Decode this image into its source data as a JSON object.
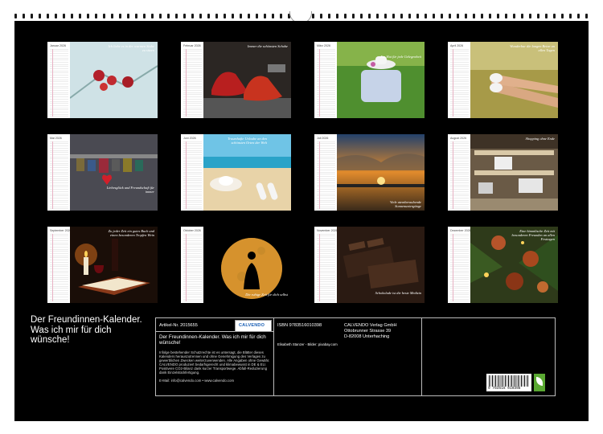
{
  "months": [
    {
      "name": "Januar 2026",
      "caption": "Ich liebe es in der warmen Stube zu sitzen"
    },
    {
      "name": "Februar 2026",
      "caption": "Immer die schönsten Schuhe"
    },
    {
      "name": "März 2026",
      "caption": "Ein Hut für jede Gelegenheit"
    },
    {
      "name": "April 2026",
      "caption": "Wunderbar die langen Beine an allen Tagen"
    },
    {
      "name": "Mai 2026",
      "caption": "Liebesglück und Freundschaft für immer"
    },
    {
      "name": "Juni 2026",
      "caption": "Traumhafte Urlaube an den schönsten Orten der Welt"
    },
    {
      "name": "Juli 2026",
      "caption": "Viele atemberaubende Sonnenuntergänge"
    },
    {
      "name": "August 2026",
      "caption": "Shopping ohne Ende"
    },
    {
      "name": "September 2026",
      "caption": "Zu jeder Zeit ein gutes Buch und einen besonderen Tropfen Wein"
    },
    {
      "name": "Oktober 2026",
      "caption": "Die ruhige Zeit für dich selbst"
    },
    {
      "name": "November 2026",
      "caption": "Schokolade ist die beste Medizin"
    },
    {
      "name": "Dezember 2026",
      "caption": "Eine himmlische Zeit mit besonderen Freunden an allen Festtagen"
    }
  ],
  "footer": {
    "title": "Der Freundinnen-Kalender. Was ich mir für dich wünsche!",
    "article_label": "Artikel-Nr. 2015655",
    "logo": "CALVENDO",
    "product_title": "Der Freundinnen-Kalender. Was ich mir für dich wünsche!",
    "legal_text": "Infolge bestehender Schutzrechte ist es untersagt, die Blätter dieses Kalenders herauszutrennen und ohne Genehmigung des Verlages zu gewerblichen Zwecken weiterzuverwenden. Alle Angaben ohne Gewähr. CALVENDO produziert bedarfsgerecht und klimabewusst in DE & EU. Positivere CO2-Bilanz dank kurzer Transportwege. Abfall-Reduzierung dank Einzelstückfertigung.",
    "contact": "E-Mail: info@calvendo.com • www.calvendo.com",
    "isbn": "ISBN 9783516010398",
    "publisher_name": "CALVENDO Verlag GmbH",
    "publisher_street": "Ottobrunner Strasse 39",
    "publisher_city": "D-82008 Unterhaching",
    "credits": "Elisabeth Stanzer - Bilder: pixabay.com",
    "barcode_number": "9 783516 010398"
  }
}
